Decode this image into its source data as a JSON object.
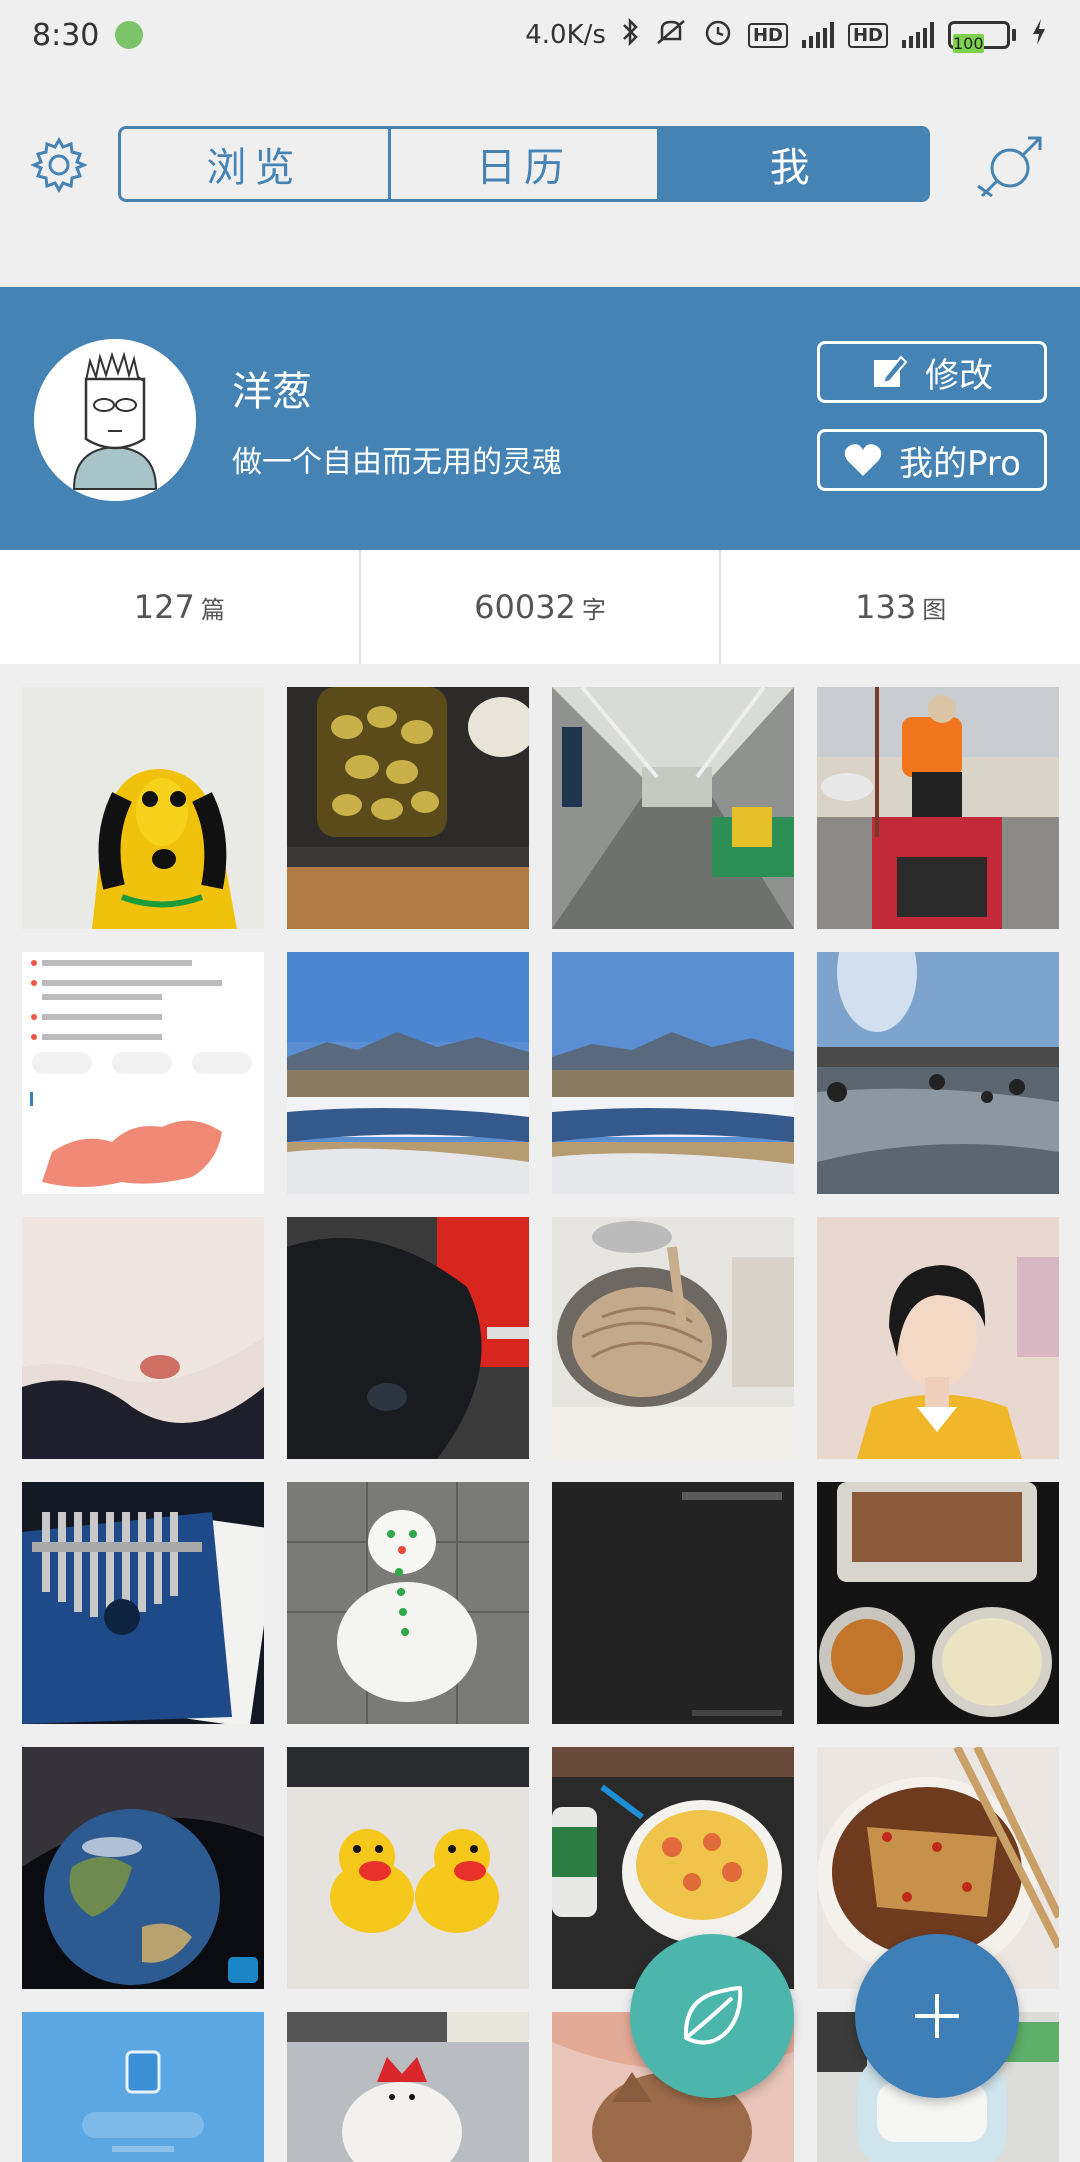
{
  "status_bar": {
    "time": "8:30",
    "net_speed": "4.0K/s",
    "hd1": "HD",
    "hd2": "HD",
    "net1": "4G",
    "net2": "4G",
    "battery": "100"
  },
  "nav": {
    "tabs": [
      {
        "label": "浏览",
        "active": false
      },
      {
        "label": "日历",
        "active": false
      },
      {
        "label": "我",
        "active": true
      }
    ]
  },
  "profile": {
    "name": "洋葱",
    "motto": "做一个自由而无用的灵魂",
    "edit_label": "修改",
    "pro_label": "我的Pro"
  },
  "stats": [
    {
      "value": "127",
      "unit": "篇"
    },
    {
      "value": "60032",
      "unit": "字"
    },
    {
      "value": "133",
      "unit": "图"
    }
  ],
  "colors": {
    "primary": "#4683b5",
    "leaf_fab": "#4db6ac",
    "add_fab": "#3f7fb7"
  },
  "photos": [
    {
      "name": "photo-yellow-costume"
    },
    {
      "name": "photo-pickled-garlic-jar"
    },
    {
      "name": "photo-subway-car"
    },
    {
      "name": "photo-person-sitting-outdoors"
    },
    {
      "name": "photo-epidemic-map-screenshot"
    },
    {
      "name": "photo-mountains-river-1"
    },
    {
      "name": "photo-mountains-river-2"
    },
    {
      "name": "photo-frozen-lake"
    },
    {
      "name": "photo-skin-closeup"
    },
    {
      "name": "photo-dark-object"
    },
    {
      "name": "photo-noodles-pot"
    },
    {
      "name": "photo-woman-portrait"
    },
    {
      "name": "photo-kalimba"
    },
    {
      "name": "photo-snowman"
    },
    {
      "name": "photo-dark-screen"
    },
    {
      "name": "photo-food-containers"
    },
    {
      "name": "photo-earth-space"
    },
    {
      "name": "photo-rubber-ducks"
    },
    {
      "name": "photo-rice-bowl"
    },
    {
      "name": "photo-chili-dish"
    },
    {
      "name": "photo-app-screenshot"
    },
    {
      "name": "photo-snow-sculpture"
    },
    {
      "name": "photo-cat-cloth"
    },
    {
      "name": "photo-kitchen-appliance"
    }
  ]
}
